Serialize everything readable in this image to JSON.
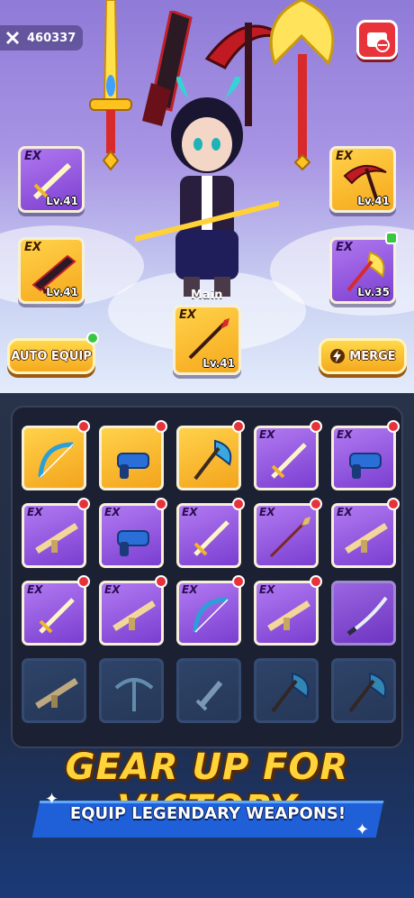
{
  "hud": {
    "score": "460337",
    "score_icon": "crossed-swords-icon",
    "no_ads_icon": "no-ads-icon"
  },
  "equipped": {
    "main_label": "Main",
    "slots": [
      {
        "id": "left-top",
        "rarity": "EX",
        "level": "Lv.41",
        "icon": "sword-icon",
        "color": "purple"
      },
      {
        "id": "left-bottom",
        "rarity": "EX",
        "level": "Lv.41",
        "icon": "flame-gun-icon",
        "color": "gold"
      },
      {
        "id": "right-top",
        "rarity": "EX",
        "level": "Lv.41",
        "icon": "scythe-icon",
        "color": "gold"
      },
      {
        "id": "right-bottom",
        "rarity": "EX",
        "level": "Lv.35",
        "icon": "axe-icon",
        "color": "purple"
      },
      {
        "id": "main",
        "rarity": "EX",
        "level": "Lv.41",
        "icon": "spear-icon",
        "color": "gold"
      }
    ]
  },
  "buttons": {
    "auto_equip": "AUTO EQUIP",
    "merge": "MERGE",
    "merge_icon": "lightning-icon"
  },
  "inventory": {
    "rows": [
      [
        {
          "color": "gold",
          "ex": "",
          "icon": "bow-icon",
          "dot": true
        },
        {
          "color": "gold",
          "ex": "",
          "icon": "blaster-icon",
          "dot": true
        },
        {
          "color": "gold",
          "ex": "",
          "icon": "axe-icon",
          "dot": true
        },
        {
          "color": "purple",
          "ex": "EX",
          "icon": "sword-icon",
          "dot": true
        },
        {
          "color": "purple",
          "ex": "EX",
          "icon": "blaster-icon",
          "dot": true
        }
      ],
      [
        {
          "color": "purple",
          "ex": "EX",
          "icon": "rifle-icon",
          "dot": true
        },
        {
          "color": "purple",
          "ex": "EX",
          "icon": "blaster-icon",
          "dot": true
        },
        {
          "color": "purple",
          "ex": "EX",
          "icon": "sword-icon",
          "dot": true
        },
        {
          "color": "purple",
          "ex": "EX",
          "icon": "spear-icon",
          "dot": true
        },
        {
          "color": "purple",
          "ex": "EX",
          "icon": "rifle-icon",
          "dot": true
        }
      ],
      [
        {
          "color": "purple",
          "ex": "EX",
          "icon": "sword-icon",
          "dot": true
        },
        {
          "color": "purple",
          "ex": "EX",
          "icon": "rifle-icon",
          "dot": true
        },
        {
          "color": "purple",
          "ex": "EX",
          "icon": "bow-icon",
          "dot": true
        },
        {
          "color": "purple",
          "ex": "EX",
          "icon": "rifle-icon",
          "dot": true
        },
        {
          "color": "plain",
          "ex": "",
          "icon": "katana-icon",
          "dot": false
        }
      ],
      [
        {
          "color": "locked",
          "ex": "",
          "icon": "rifle-icon",
          "dot": false
        },
        {
          "color": "locked",
          "ex": "",
          "icon": "crossbow-icon",
          "dot": false
        },
        {
          "color": "locked",
          "ex": "",
          "icon": "dagger-icon",
          "dot": false
        },
        {
          "color": "locked",
          "ex": "",
          "icon": "axe-icon",
          "dot": false
        },
        {
          "color": "locked",
          "ex": "",
          "icon": "axe-icon",
          "dot": false
        }
      ]
    ]
  },
  "promo": {
    "headline": "GEAR UP FOR VICTORY",
    "subline": "EQUIP LEGENDARY WEAPONS!"
  },
  "colors": {
    "gold": "#f6b52a",
    "purple": "#8e4fe0",
    "red_dot": "#e6333a",
    "green": "#38c742"
  }
}
